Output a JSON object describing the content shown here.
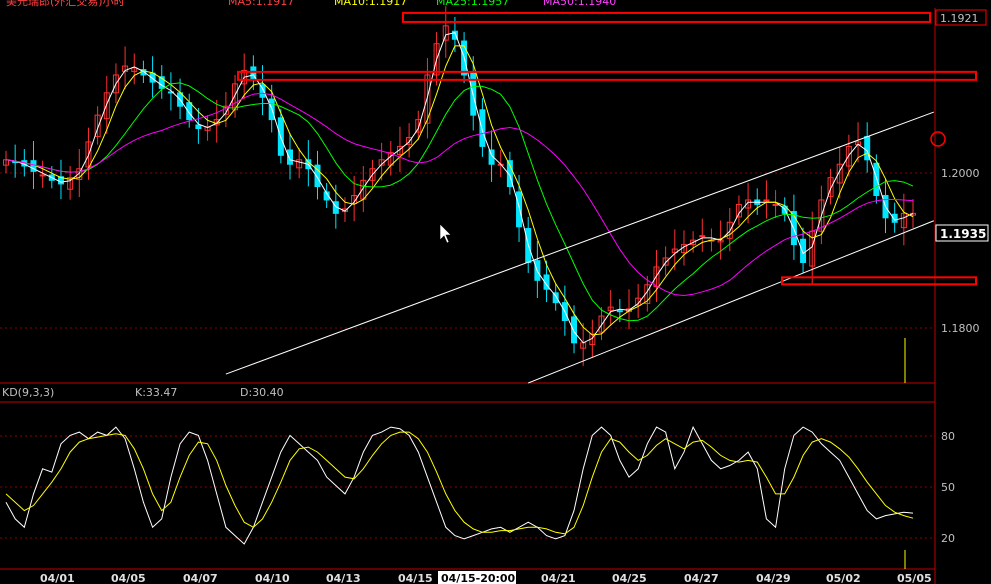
{
  "header": {
    "title": "美元瑞郎(外汇交易)小时",
    "ma5": "MA5:1.1917",
    "ma10": "MA10:1.1917",
    "ma25": "MA25:1.1957",
    "ma50": "MA50:1.1940"
  },
  "kd_panel": {
    "label": "KD(9,3,3)",
    "k_label": "K:33.47",
    "d_label": "D:30.40"
  },
  "price_axis": {
    "labels": [
      "1.2000",
      "1.1800"
    ],
    "current_price": "1.1935",
    "top_price": "1.1921"
  },
  "kd_axis": {
    "labels": [
      "80",
      "50",
      "20"
    ]
  },
  "x_axis": {
    "labels": [
      "04/01",
      "04/05",
      "04/07",
      "04/10",
      "04/13",
      "04/15",
      "04/21",
      "04/25",
      "04/27",
      "04/29",
      "05/02",
      "05/05"
    ],
    "cursor_label": "04/15-20:00"
  },
  "colors": {
    "background": "#000000",
    "candle_up": "#ff3030",
    "candle_down": "#00e6ff",
    "ma5": "#ffffff",
    "ma10": "#ffff00",
    "ma25": "#00ff00",
    "ma50": "#ff00ff",
    "k_line": "#ffffff",
    "d_line": "#ffff00",
    "annotation": "#ff0000",
    "grid": "#8b0000",
    "channel": "#ffffff"
  },
  "chart_data": [
    {
      "type": "candlestick",
      "title": "美元瑞郎(外汇交易)小时",
      "ylim": [
        1.1745,
        1.2165
      ],
      "moving_averages": {
        "MA5": 1.1917,
        "MA10": 1.1917,
        "MA25": 1.1957,
        "MA50": 1.194
      },
      "current_price": 1.1935,
      "close": [
        1.1995,
        1.1992,
        1.1988,
        1.1982,
        1.1978,
        1.1972,
        1.1968,
        1.1975,
        1.1985,
        1.2015,
        1.2045,
        1.207,
        1.209,
        1.21,
        1.2098,
        1.209,
        1.2082,
        1.2075,
        1.207,
        1.2055,
        1.204,
        1.203,
        1.2032,
        1.204,
        1.2055,
        1.208,
        1.2095,
        1.2085,
        1.2065,
        1.204,
        1.2,
        1.199,
        1.1995,
        1.1985,
        1.1965,
        1.195,
        1.1935,
        1.194,
        1.1955,
        1.1972,
        1.1985,
        1.1995,
        1.2003,
        1.201,
        1.202,
        1.204,
        1.209,
        1.2125,
        1.2145,
        1.213,
        1.209,
        1.2045,
        1.201,
        1.199,
        1.199,
        1.1965,
        1.192,
        1.188,
        1.186,
        1.185,
        1.1835,
        1.1815,
        1.179,
        1.179,
        1.18,
        1.182,
        1.183,
        1.1825,
        1.1828,
        1.184,
        1.1855,
        1.1875,
        1.1885,
        1.1895,
        1.19,
        1.1905,
        1.191,
        1.1905,
        1.1905,
        1.1925,
        1.1945,
        1.195,
        1.1945,
        1.195,
        1.1945,
        1.1935,
        1.19,
        1.188,
        1.1915,
        1.195,
        1.1975,
        1.199,
        1.201,
        1.2015,
        1.1995,
        1.1955,
        1.193,
        1.1925,
        1.1935,
        1.1935
      ],
      "channel": {
        "upper": [
          [
            24,
            1.1755
          ],
          [
            98,
            1.2035
          ]
        ],
        "lower": [
          [
            57,
            1.1745
          ],
          [
            98,
            1.192
          ]
        ]
      },
      "annotations": {
        "resistance_levels": [
          1.2155,
          1.2089
        ],
        "support_level": 1.186,
        "top_price_label": 1.1921
      },
      "price_labels": [
        1.2,
        1.18
      ]
    },
    {
      "type": "line",
      "title": "KD(9,3,3)",
      "ylim": [
        0,
        100
      ],
      "yticks": [
        80,
        50,
        20
      ],
      "x": [
        "04/01",
        "04/05",
        "04/07",
        "04/10",
        "04/13",
        "04/15",
        "04/21",
        "04/25",
        "04/27",
        "04/29",
        "05/02",
        "05/05"
      ],
      "series": [
        {
          "name": "K",
          "last": 33.47,
          "values": [
            40,
            30,
            25,
            45,
            60,
            58,
            75,
            80,
            82,
            78,
            82,
            80,
            85,
            78,
            60,
            40,
            25,
            30,
            55,
            75,
            82,
            80,
            65,
            45,
            25,
            20,
            15,
            25,
            40,
            55,
            70,
            80,
            75,
            70,
            65,
            55,
            50,
            45,
            55,
            70,
            80,
            82,
            85,
            84,
            80,
            70,
            55,
            40,
            25,
            20,
            18,
            20,
            22,
            24,
            25,
            22,
            25,
            28,
            25,
            20,
            18,
            20,
            35,
            60,
            80,
            85,
            80,
            65,
            55,
            60,
            75,
            85,
            82,
            60,
            70,
            85,
            75,
            65,
            60,
            62,
            65,
            70,
            60,
            30,
            25,
            60,
            80,
            85,
            82,
            75,
            70,
            65,
            55,
            45,
            35,
            30,
            32,
            33,
            34,
            33.47
          ]
        },
        {
          "name": "D",
          "last": 30.4,
          "values": [
            45,
            40,
            35,
            38,
            45,
            52,
            60,
            70,
            76,
            78,
            79,
            80,
            81,
            80,
            72,
            60,
            45,
            35,
            40,
            55,
            68,
            76,
            75,
            65,
            50,
            38,
            28,
            25,
            30,
            40,
            52,
            65,
            72,
            73,
            70,
            65,
            60,
            55,
            54,
            60,
            68,
            75,
            80,
            82,
            82,
            78,
            70,
            58,
            45,
            35,
            28,
            24,
            22,
            22,
            23,
            23,
            24,
            25,
            25,
            24,
            22,
            21,
            25,
            38,
            55,
            70,
            78,
            76,
            70,
            65,
            68,
            74,
            78,
            75,
            72,
            76,
            77,
            73,
            68,
            65,
            64,
            65,
            64,
            55,
            45,
            45,
            55,
            68,
            76,
            78,
            76,
            72,
            67,
            60,
            52,
            45,
            38,
            34,
            32,
            30.4
          ]
        }
      ]
    }
  ]
}
